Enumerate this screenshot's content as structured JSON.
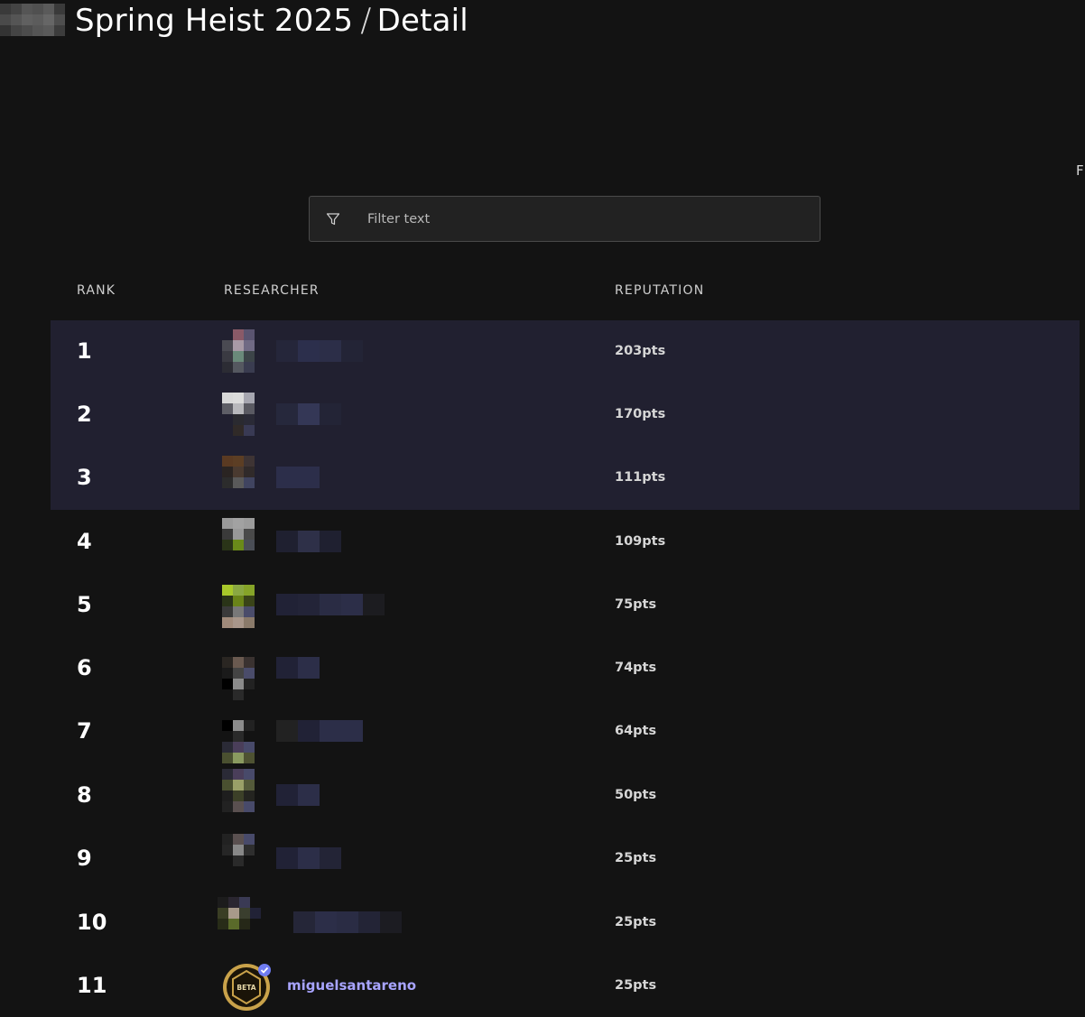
{
  "header": {
    "title": "Spring Heist 2025",
    "separator": "/",
    "subtitle": "Detail",
    "edge_glyph": "F"
  },
  "filter": {
    "icon": "filter-icon",
    "placeholder": "Filter text",
    "value": ""
  },
  "table": {
    "columns": [
      "RANK",
      "RESEARCHER",
      "REPUTATION"
    ],
    "rows": [
      {
        "rank": "1",
        "reputation": "203pts",
        "highlight": true
      },
      {
        "rank": "2",
        "reputation": "170pts",
        "highlight": true
      },
      {
        "rank": "3",
        "reputation": "111pts",
        "highlight": true
      },
      {
        "rank": "4",
        "reputation": "109pts",
        "highlight": false
      },
      {
        "rank": "5",
        "reputation": "75pts",
        "highlight": false
      },
      {
        "rank": "6",
        "reputation": "74pts",
        "highlight": false
      },
      {
        "rank": "7",
        "reputation": "64pts",
        "highlight": false
      },
      {
        "rank": "8",
        "reputation": "50pts",
        "highlight": false
      },
      {
        "rank": "9",
        "reputation": "25pts",
        "highlight": false
      },
      {
        "rank": "10",
        "reputation": "25pts",
        "highlight": false
      },
      {
        "rank": "11",
        "reputation": "25pts",
        "highlight": false,
        "username": "miguelsantareno",
        "badge_text": "BETA"
      }
    ]
  },
  "colors": {
    "background": "#131313",
    "highlight_row": "#212030",
    "username": "#a8a4ff",
    "verified": "#6f7cf2",
    "badge_gold": "#c9a24a"
  }
}
